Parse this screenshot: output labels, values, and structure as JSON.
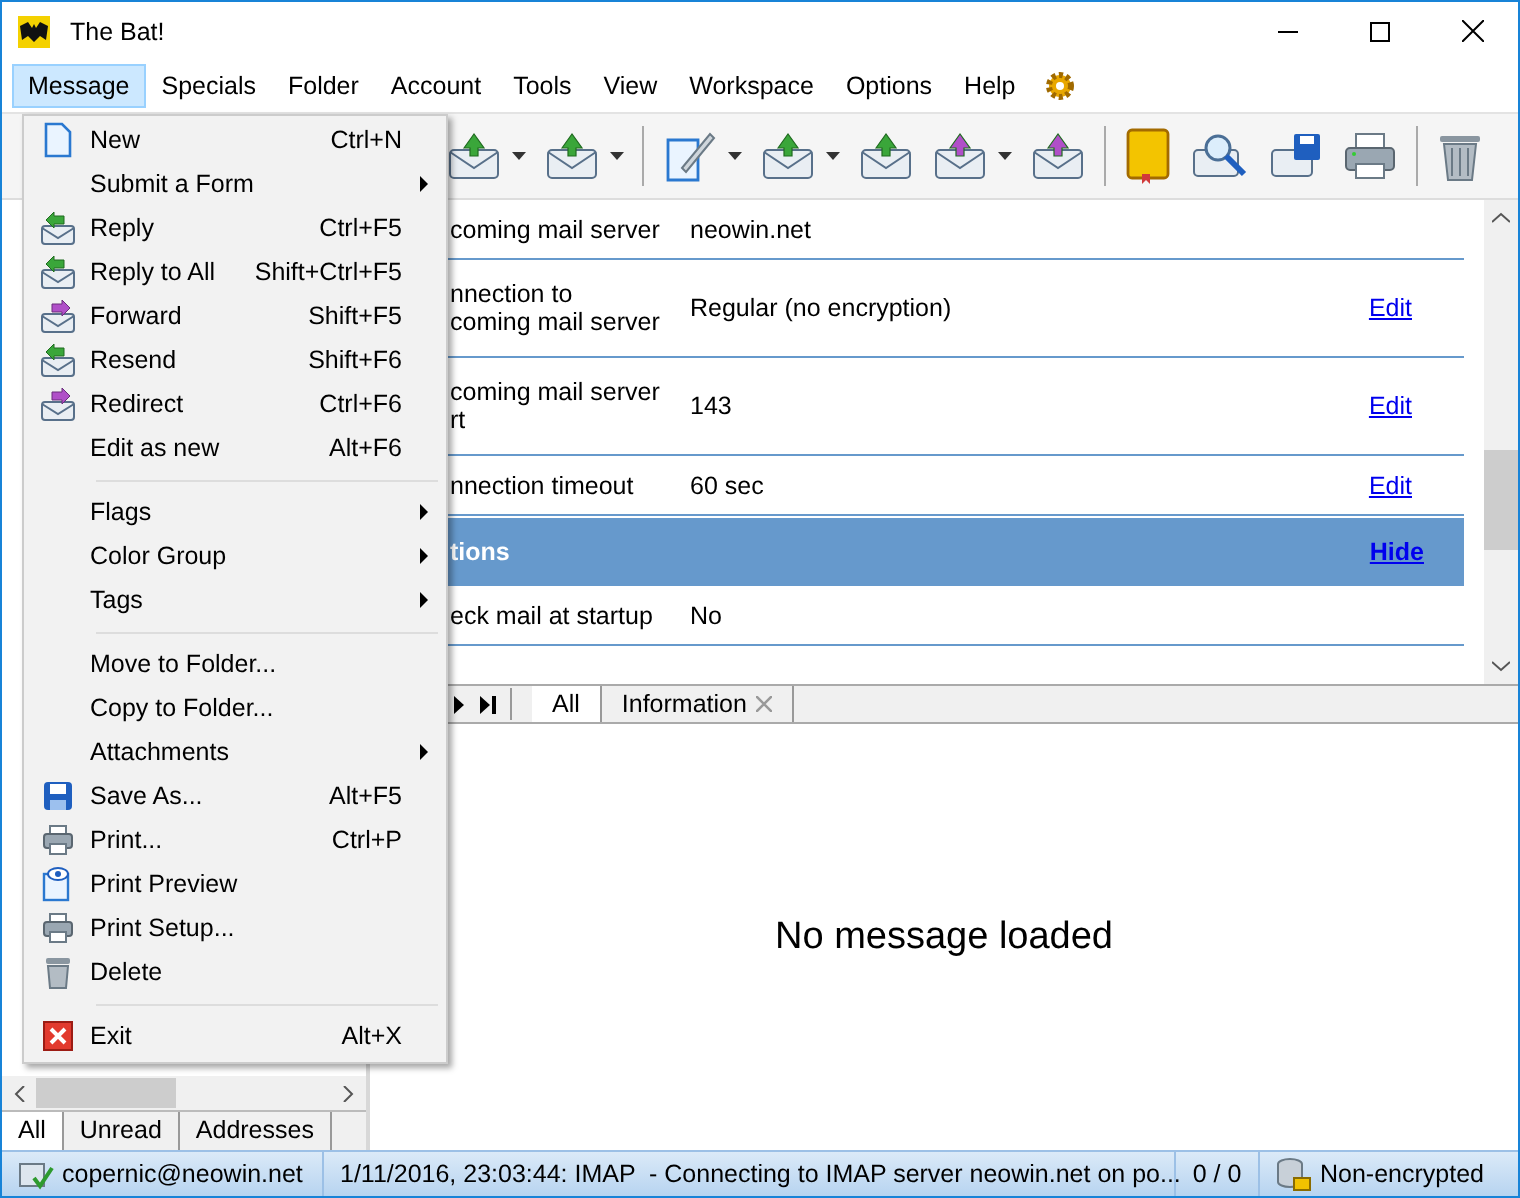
{
  "window": {
    "title": "The Bat!"
  },
  "menubar": [
    {
      "label": "Message",
      "selected": true
    },
    {
      "label": "Specials",
      "selected": false
    },
    {
      "label": "Folder",
      "selected": false
    },
    {
      "label": "Account",
      "selected": false
    },
    {
      "label": "Tools",
      "selected": false
    },
    {
      "label": "View",
      "selected": false
    },
    {
      "label": "Workspace",
      "selected": false
    },
    {
      "label": "Options",
      "selected": false
    },
    {
      "label": "Help",
      "selected": false
    }
  ],
  "account_settings": [
    {
      "kind": "row",
      "label": "coming mail server",
      "value": "neowin.net"
    },
    {
      "kind": "row",
      "label": "nnection to\ncoming mail server",
      "value": "Regular (no encryption)",
      "link": "Edit"
    },
    {
      "kind": "row",
      "label": "coming mail server\nrt",
      "value": "143",
      "link": "Edit"
    },
    {
      "kind": "row",
      "label": "nnection timeout",
      "value": "60 sec",
      "link": "Edit"
    },
    {
      "kind": "section",
      "label": "tions",
      "link": "Hide"
    },
    {
      "kind": "row",
      "label": "eck mail at startup",
      "value": "No"
    }
  ],
  "message_tabs": [
    {
      "label": "All",
      "selected": true,
      "closable": false
    },
    {
      "label": "Information",
      "selected": false,
      "closable": true
    }
  ],
  "viewer": {
    "empty_text": "No message loaded"
  },
  "folder_tabs": [
    {
      "label": "All",
      "selected": true
    },
    {
      "label": "Unread",
      "selected": false
    },
    {
      "label": "Addresses",
      "selected": false
    }
  ],
  "status_bar": {
    "account": "copernic@neowin.net",
    "log": "1/11/2016, 23:03:44: IMAP  - Connecting to IMAP server neowin.net on po...",
    "counter": "0 / 0",
    "encryption": "Non-encrypted"
  },
  "open_menu": {
    "groups": [
      [
        {
          "label": "New",
          "shortcut": "Ctrl+N",
          "submenu": false
        },
        {
          "label": "Submit a Form",
          "submenu": true
        },
        {
          "label": "Reply",
          "shortcut": "Ctrl+F5",
          "submenu": false
        },
        {
          "label": "Reply to All",
          "shortcut": "Shift+Ctrl+F5",
          "submenu": false
        },
        {
          "label": "Forward",
          "shortcut": "Shift+F5",
          "submenu": false
        },
        {
          "label": "Resend",
          "shortcut": "Shift+F6",
          "submenu": false
        },
        {
          "label": "Redirect",
          "shortcut": "Ctrl+F6",
          "submenu": false
        },
        {
          "label": "Edit as new",
          "shortcut": "Alt+F6",
          "submenu": false
        }
      ],
      [
        {
          "label": "Flags",
          "submenu": true
        },
        {
          "label": "Color Group",
          "submenu": true
        },
        {
          "label": "Tags",
          "submenu": true
        }
      ],
      [
        {
          "label": "Move to Folder...",
          "submenu": false
        },
        {
          "label": "Copy to Folder...",
          "submenu": false
        },
        {
          "label": "Attachments",
          "submenu": true
        },
        {
          "label": "Save As...",
          "shortcut": "Alt+F5",
          "submenu": false
        },
        {
          "label": "Print...",
          "shortcut": "Ctrl+P",
          "submenu": false
        },
        {
          "label": "Print Preview",
          "submenu": false
        },
        {
          "label": "Print Setup...",
          "submenu": false
        },
        {
          "label": "Delete",
          "submenu": false
        }
      ],
      [
        {
          "label": "Exit",
          "shortcut": "Alt+X",
          "submenu": false
        }
      ]
    ]
  }
}
